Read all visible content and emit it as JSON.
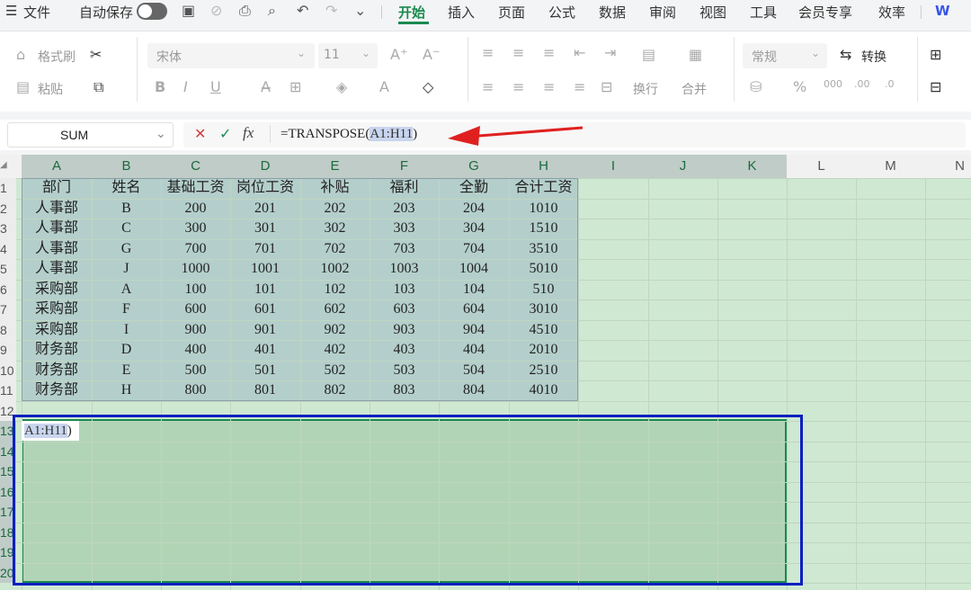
{
  "menu": {
    "file": "文件",
    "autosave": "自动保存",
    "tabs": [
      "开始",
      "插入",
      "页面",
      "公式",
      "数据",
      "审阅",
      "视图",
      "工具",
      "会员专享",
      "效率"
    ],
    "brand": "W"
  },
  "ribbon": {
    "format_painter": "格式刷",
    "paste": "粘贴",
    "font": "宋体",
    "size": "11",
    "wrap": "换行",
    "merge": "合并",
    "numfmt": "常规",
    "convert": "转换"
  },
  "formula_bar": {
    "name_box": "SUM",
    "cancel": "✕",
    "confirm": "✓",
    "fx": "fx",
    "formula_prefix": "=TRANSPOSE(",
    "formula_ref": "A1:H11",
    "formula_suffix": ")"
  },
  "columns": [
    "A",
    "B",
    "C",
    "D",
    "E",
    "F",
    "G",
    "H",
    "I",
    "J",
    "K",
    "L",
    "M",
    "N"
  ],
  "rows": [
    "1",
    "2",
    "3",
    "4",
    "5",
    "6",
    "7",
    "8",
    "9",
    "10",
    "11",
    "12",
    "13",
    "14",
    "15",
    "16",
    "17",
    "18",
    "19",
    "20"
  ],
  "table": {
    "header": [
      "部门",
      "姓名",
      "基础工资",
      "岗位工资",
      "补贴",
      "福利",
      "全勤",
      "合计工资"
    ],
    "data": [
      [
        "人事部",
        "B",
        "200",
        "201",
        "202",
        "203",
        "204",
        "1010"
      ],
      [
        "人事部",
        "C",
        "300",
        "301",
        "302",
        "303",
        "304",
        "1510"
      ],
      [
        "人事部",
        "G",
        "700",
        "701",
        "702",
        "703",
        "704",
        "3510"
      ],
      [
        "人事部",
        "J",
        "1000",
        "1001",
        "1002",
        "1003",
        "1004",
        "5010"
      ],
      [
        "采购部",
        "A",
        "100",
        "101",
        "102",
        "103",
        "104",
        "510"
      ],
      [
        "采购部",
        "F",
        "600",
        "601",
        "602",
        "603",
        "604",
        "3010"
      ],
      [
        "采购部",
        "I",
        "900",
        "901",
        "902",
        "903",
        "904",
        "4510"
      ],
      [
        "财务部",
        "D",
        "400",
        "401",
        "402",
        "403",
        "404",
        "2010"
      ],
      [
        "财务部",
        "E",
        "500",
        "501",
        "502",
        "503",
        "504",
        "2510"
      ],
      [
        "财务部",
        "H",
        "800",
        "801",
        "802",
        "803",
        "804",
        "4010"
      ]
    ]
  },
  "cell_edit": {
    "ref": "A1:H11",
    "suffix": ")"
  },
  "colors": {
    "accent": "#1a8a4e",
    "arrow": "#e02020",
    "highlight_box": "#0a1fc0"
  }
}
